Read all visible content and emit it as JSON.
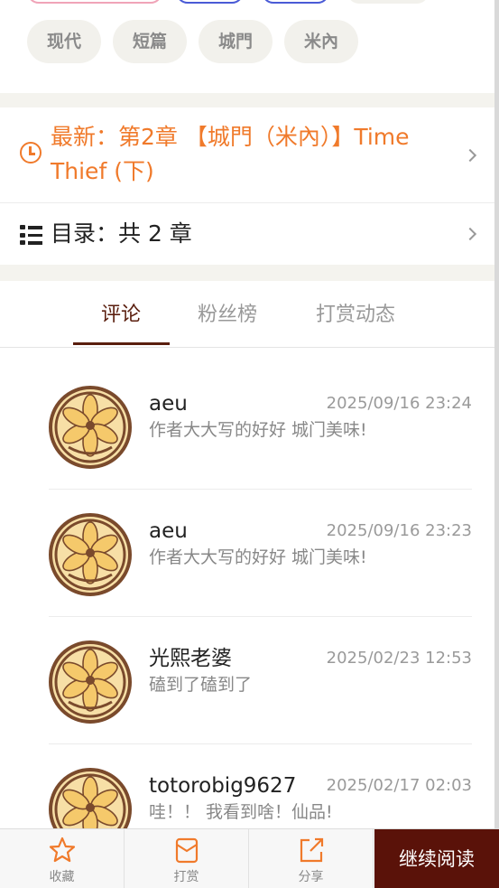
{
  "tags": [
    "现代",
    "短篇",
    "城門",
    "米內"
  ],
  "latest": {
    "text": "最新：第2章 【城門（米內）】Time Thief (下)"
  },
  "toc": {
    "text": "目录：共 2 章"
  },
  "tabs": [
    {
      "label": "评论",
      "active": true
    },
    {
      "label": "粉丝榜",
      "active": false
    },
    {
      "label": "打赏动态",
      "active": false
    }
  ],
  "comments": [
    {
      "name": "aeu",
      "time": "2025/09/16 23:24",
      "text": "作者大大写的好好 城门美味!"
    },
    {
      "name": "aeu",
      "time": "2025/09/16 23:23",
      "text": "作者大大写的好好 城门美味!"
    },
    {
      "name": "光熙老婆",
      "time": "2025/02/23 12:53",
      "text": "磕到了磕到了"
    },
    {
      "name": "totorobig9627",
      "time": "2025/02/17 02:03",
      "text": "哇！！ 我看到啥！仙品!"
    }
  ],
  "bottom_bar": {
    "favorite_label": "收藏",
    "tip_label": "打赏",
    "share_label": "分享",
    "continue_label": "继续阅读"
  },
  "colors": {
    "accent_orange": "#f07a2b",
    "brand_dark": "#5a1209",
    "tab_active": "#5a1e0e"
  }
}
